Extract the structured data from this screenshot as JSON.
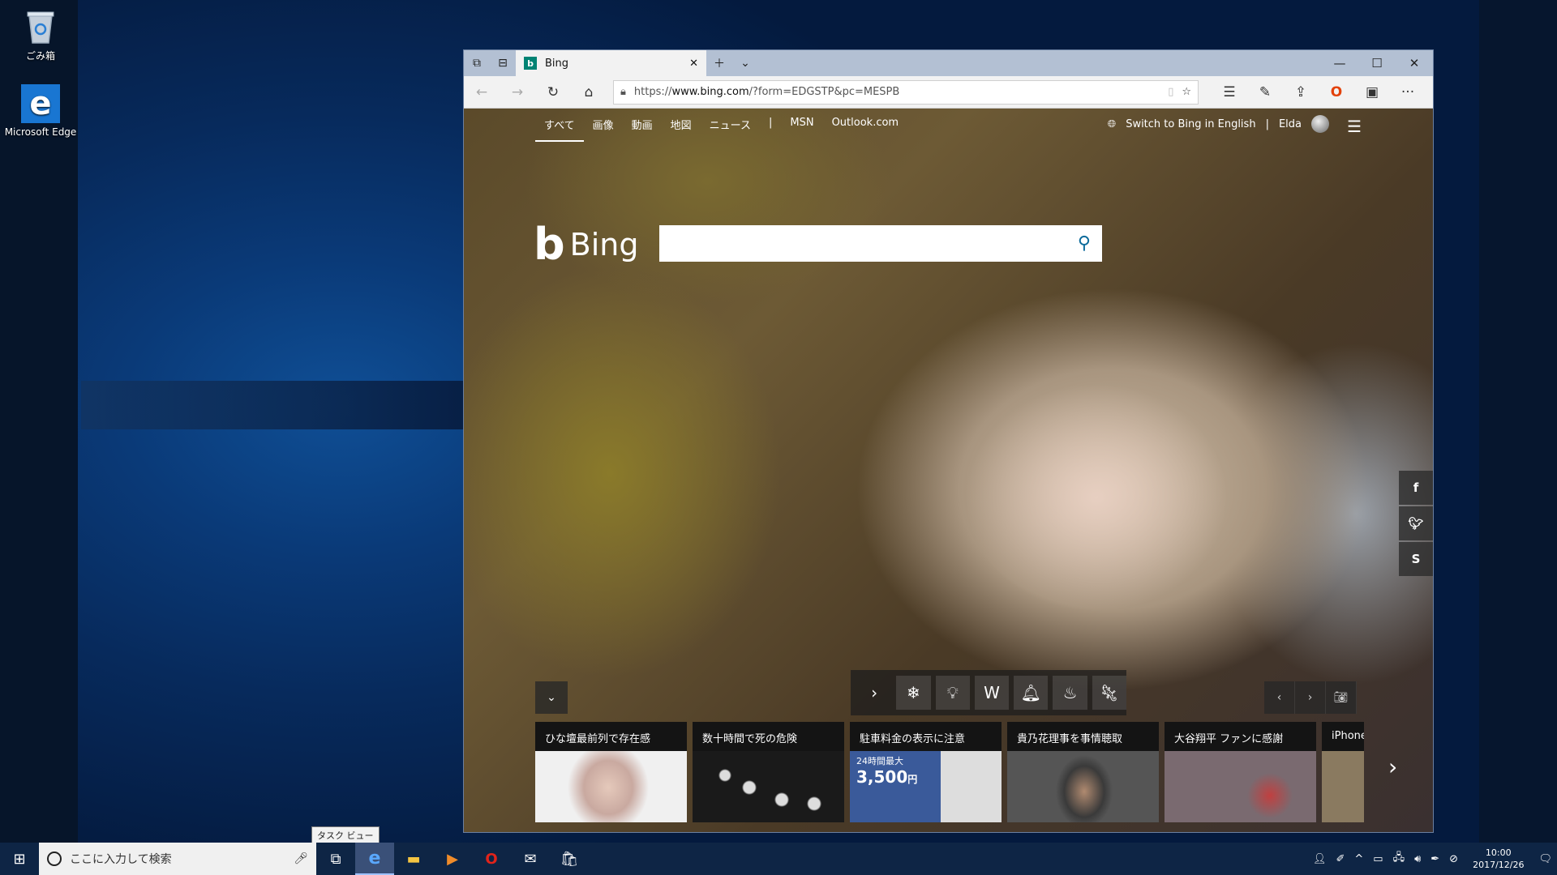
{
  "desktop": {
    "icons": [
      {
        "label": "ごみ箱",
        "icon": "recycle-bin-icon"
      },
      {
        "label": "Microsoft Edge",
        "icon": "edge-icon"
      }
    ]
  },
  "browser": {
    "tab": {
      "title": "Bing",
      "favicon": "b"
    },
    "address": {
      "prefix": "https://",
      "domain": "www.bing.com",
      "rest": "/?form=EDGSTP&pc=MESPB"
    },
    "window_controls": [
      "—",
      "☐",
      "✕"
    ]
  },
  "bing": {
    "nav": [
      "すべて",
      "画像",
      "動画",
      "地図",
      "ニュース",
      "|",
      "MSN",
      "Outlook.com"
    ],
    "switch_lang": "Switch to Bing in English",
    "separator": "|",
    "user": "Elda",
    "logo_text": "Bing",
    "news": [
      {
        "caption": "ひな壇最前列で存在感",
        "color": "#c9a9a0"
      },
      {
        "caption": "数十時間で死の危険",
        "color": "#333333"
      },
      {
        "caption": "駐車料金の表示に注意",
        "color": "#3a5a9a",
        "badge1": "24時間最大",
        "badge2": "3,500",
        "badge3": "円"
      },
      {
        "caption": "貴乃花理事を事情聴取",
        "color": "#4a4a4a"
      },
      {
        "caption": "大谷翔平 ファンに感謝",
        "color": "#7a6a70"
      },
      {
        "caption": "iPhone",
        "color": "#8a7a60"
      }
    ]
  },
  "taskbar": {
    "search_placeholder": "ここに入力して検索",
    "tooltip": "タスク ビュー",
    "time": "10:00",
    "date": "2017/12/26"
  }
}
